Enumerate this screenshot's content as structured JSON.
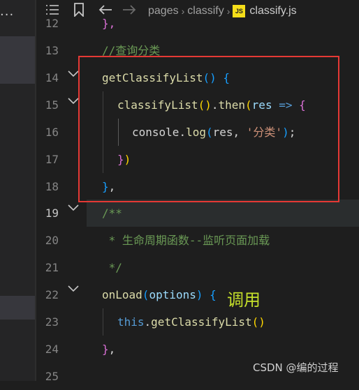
{
  "sidebar": {
    "overflow_label": "..."
  },
  "breadcrumb": {
    "icons": [
      "list-icon",
      "bookmark-icon",
      "arrow-left-icon",
      "arrow-right-icon"
    ],
    "segments": [
      "pages",
      "classify"
    ],
    "file_badge": "JS",
    "file_name": "classify.js"
  },
  "editor": {
    "line_numbers": [
      "12",
      "13",
      "14",
      "15",
      "16",
      "17",
      "18",
      "19",
      "20",
      "21",
      "22",
      "23",
      "24",
      "25"
    ],
    "active_line": "19",
    "lines": {
      "l12": "},",
      "l13": "//查询分类",
      "l14": {
        "fn": "getClassifyList",
        "p_open": "(",
        "p_close": ")",
        "brace": "{"
      },
      "l15": {
        "fn": "classifyList",
        "p": "()",
        "dot": ".",
        "then": "then",
        "p_open": "(",
        "arg": "res",
        "arrow": "=>",
        "brace": "{"
      },
      "l16": {
        "obj": "console",
        "dot": ".",
        "fn": "log",
        "p_open": "(",
        "arg": "res",
        "comma": ", ",
        "str": "'分类'",
        "p_close": ")",
        "semi": ";"
      },
      "l17": {
        "brace": "}",
        "paren": ")"
      },
      "l18": {
        "brace": "}",
        "comma": ","
      },
      "l19": "/**",
      "l20": " * 生命周期函数--监听页面加载",
      "l21": " */",
      "l22": {
        "fn": "onLoad",
        "p_open": "(",
        "arg": "options",
        "p_close": ")",
        "brace": "{"
      },
      "l23": {
        "this": "this",
        "dot": ".",
        "fn": "getClassifyList",
        "p": "()"
      },
      "l24": {
        "brace": "}",
        "comma": ","
      }
    }
  },
  "annotation": {
    "text": "调用",
    "color": "#c5e02a",
    "box_color": "#e53935"
  },
  "watermark": "CSDN @编的过程"
}
